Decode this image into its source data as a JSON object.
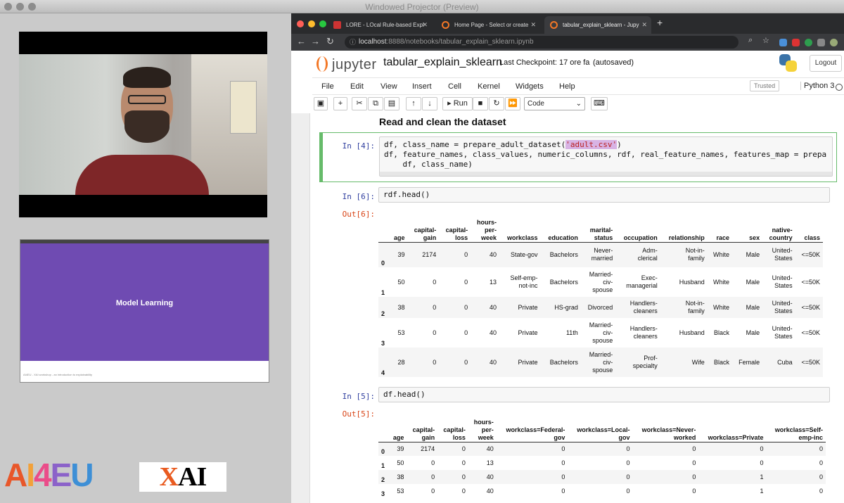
{
  "window": {
    "title": "Windowed Projector (Preview)"
  },
  "slide": {
    "title": "Model Learning",
    "footer": "AI4EU - XAI workshop - an introduction to explainability"
  },
  "logos": {
    "ai4eu": "AI4EU",
    "xai": "XAI"
  },
  "colors": {
    "jupyter_orange": "#f37726",
    "slide_purple": "#6f4bb2",
    "prompt_in": "#303f9f",
    "prompt_out": "#d84315",
    "selected_cell": "#66bb6a"
  },
  "browser": {
    "tabs": [
      {
        "label": "LORE - LOcal Rule-based Expl",
        "icon": "favicon-icon",
        "active": false
      },
      {
        "label": "Home Page - Select or create",
        "icon": "jupyter-favicon-icon",
        "active": false
      },
      {
        "label": "tabular_explain_sklearn - Jupy",
        "icon": "jupyter-favicon-icon",
        "active": true
      }
    ],
    "url": {
      "host": "localhost",
      "path": ":8888/notebooks/tabular_explain_sklearn.ipynb"
    }
  },
  "jupyter": {
    "logo_text": "jupyter",
    "notebook_name": "tabular_explain_sklearn",
    "checkpoint": "Last Checkpoint: 17 ore fa",
    "autosaved": "(autosaved)",
    "logout": "Logout",
    "menu": [
      "File",
      "Edit",
      "View",
      "Insert",
      "Cell",
      "Kernel",
      "Widgets",
      "Help"
    ],
    "trusted": "Trusted",
    "kernel": "Python 3",
    "toolbar": {
      "run": "Run",
      "cell_type": "Code"
    }
  },
  "notebook": {
    "heading": "Read and clean the dataset",
    "cell4": {
      "prompt": "In [4]:",
      "line1_a": "df, class_name = prepare_adult_dataset(",
      "line1_str": "'adult.csv'",
      "line1_b": ")",
      "line2": "df, feature_names, class_values, numeric_columns, rdf, real_feature_names, features_map = prepa",
      "line3": "    df, class_name)"
    },
    "cell6": {
      "prompt": "In [6]:",
      "code": "rdf.head()",
      "out_prompt": "Out[6]:",
      "columns": [
        [
          "age"
        ],
        [
          "capital-",
          "gain"
        ],
        [
          "capital-",
          "loss"
        ],
        [
          "hours-",
          "per-",
          "week"
        ],
        [
          "workclass"
        ],
        [
          "education"
        ],
        [
          "marital-",
          "status"
        ],
        [
          "occupation"
        ],
        [
          "relationship"
        ],
        [
          "race"
        ],
        [
          "sex"
        ],
        [
          "native-",
          "country"
        ],
        [
          "class"
        ]
      ],
      "rows": [
        {
          "idx": "0",
          "cells": [
            [
              "39"
            ],
            [
              "2174"
            ],
            [
              "0"
            ],
            [
              "40"
            ],
            [
              "State-gov"
            ],
            [
              "Bachelors"
            ],
            [
              "Never-",
              "married"
            ],
            [
              "Adm-",
              "clerical"
            ],
            [
              "Not-in-",
              "family"
            ],
            [
              "White"
            ],
            [
              "Male"
            ],
            [
              "United-",
              "States"
            ],
            [
              "<=50K"
            ]
          ]
        },
        {
          "idx": "1",
          "cells": [
            [
              "50"
            ],
            [
              "0"
            ],
            [
              "0"
            ],
            [
              "13"
            ],
            [
              "Self-emp-",
              "not-inc"
            ],
            [
              "Bachelors"
            ],
            [
              "Married-",
              "civ-",
              "spouse"
            ],
            [
              "Exec-",
              "managerial"
            ],
            [
              "Husband"
            ],
            [
              "White"
            ],
            [
              "Male"
            ],
            [
              "United-",
              "States"
            ],
            [
              "<=50K"
            ]
          ]
        },
        {
          "idx": "2",
          "cells": [
            [
              "38"
            ],
            [
              "0"
            ],
            [
              "0"
            ],
            [
              "40"
            ],
            [
              "Private"
            ],
            [
              "HS-grad"
            ],
            [
              "Divorced"
            ],
            [
              "Handlers-",
              "cleaners"
            ],
            [
              "Not-in-",
              "family"
            ],
            [
              "White"
            ],
            [
              "Male"
            ],
            [
              "United-",
              "States"
            ],
            [
              "<=50K"
            ]
          ]
        },
        {
          "idx": "3",
          "cells": [
            [
              "53"
            ],
            [
              "0"
            ],
            [
              "0"
            ],
            [
              "40"
            ],
            [
              "Private"
            ],
            [
              "11th"
            ],
            [
              "Married-",
              "civ-",
              "spouse"
            ],
            [
              "Handlers-",
              "cleaners"
            ],
            [
              "Husband"
            ],
            [
              "Black"
            ],
            [
              "Male"
            ],
            [
              "United-",
              "States"
            ],
            [
              "<=50K"
            ]
          ]
        },
        {
          "idx": "4",
          "cells": [
            [
              "28"
            ],
            [
              "0"
            ],
            [
              "0"
            ],
            [
              "40"
            ],
            [
              "Private"
            ],
            [
              "Bachelors"
            ],
            [
              "Married-",
              "civ-",
              "spouse"
            ],
            [
              "Prof-",
              "specialty"
            ],
            [
              "Wife"
            ],
            [
              "Black"
            ],
            [
              "Female"
            ],
            [
              "Cuba"
            ],
            [
              "<=50K"
            ]
          ]
        }
      ]
    },
    "cell5": {
      "prompt": "In [5]:",
      "code": "df.head()",
      "out_prompt": "Out[5]:",
      "columns": [
        [
          "age"
        ],
        [
          "capital-",
          "gain"
        ],
        [
          "capital-",
          "loss"
        ],
        [
          "hours-",
          "per-",
          "week"
        ],
        [
          "workclass=Federal-",
          "gov"
        ],
        [
          "workclass=Local-",
          "gov"
        ],
        [
          "workclass=Never-",
          "worked"
        ],
        [
          "workclass=Private"
        ],
        [
          "workclass=Self-",
          "emp-inc"
        ]
      ],
      "rows": [
        {
          "idx": "0",
          "cells": [
            [
              "39"
            ],
            [
              "2174"
            ],
            [
              "0"
            ],
            [
              "40"
            ],
            [
              "0"
            ],
            [
              "0"
            ],
            [
              "0"
            ],
            [
              "0"
            ],
            [
              "0"
            ]
          ]
        },
        {
          "idx": "1",
          "cells": [
            [
              "50"
            ],
            [
              "0"
            ],
            [
              "0"
            ],
            [
              "13"
            ],
            [
              "0"
            ],
            [
              "0"
            ],
            [
              "0"
            ],
            [
              "0"
            ],
            [
              "0"
            ]
          ]
        },
        {
          "idx": "2",
          "cells": [
            [
              "38"
            ],
            [
              "0"
            ],
            [
              "0"
            ],
            [
              "40"
            ],
            [
              "0"
            ],
            [
              "0"
            ],
            [
              "0"
            ],
            [
              "1"
            ],
            [
              "0"
            ]
          ]
        },
        {
          "idx": "3",
          "cells": [
            [
              "53"
            ],
            [
              "0"
            ],
            [
              "0"
            ],
            [
              "40"
            ],
            [
              "0"
            ],
            [
              "0"
            ],
            [
              "0"
            ],
            [
              "1"
            ],
            [
              "0"
            ]
          ]
        }
      ]
    }
  }
}
